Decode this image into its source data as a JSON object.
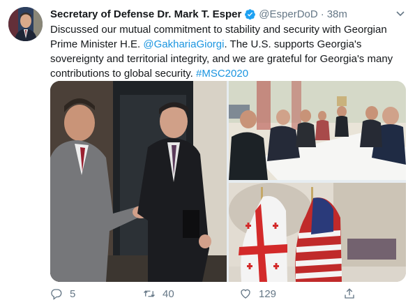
{
  "author": {
    "name": "Secretary of Defense Dr. Mark T. Esper",
    "handle": "@EsperDoD",
    "separator": "·",
    "time": "38m"
  },
  "tweet": {
    "text_1": "Discussed our mutual commitment to stability and security with Georgian Prime Minister H.E. ",
    "mention": "@GakhariaGiorgi",
    "text_2": ". The U.S. supports Georgia's sovereignty and territorial integrity, and we are grateful for Georgia's many contributions to global security. ",
    "hashtag": "#MSC2020"
  },
  "actions": {
    "replies": "5",
    "retweets": "40",
    "likes": "129"
  },
  "icons": {
    "verified": "verified-badge-icon",
    "caret": "chevron-down-icon",
    "reply": "reply-icon",
    "retweet": "retweet-icon",
    "like": "heart-icon",
    "share": "share-icon"
  },
  "colors": {
    "link": "#1b95e0",
    "secondary_text": "#657786",
    "verified": "#1da1f2"
  }
}
